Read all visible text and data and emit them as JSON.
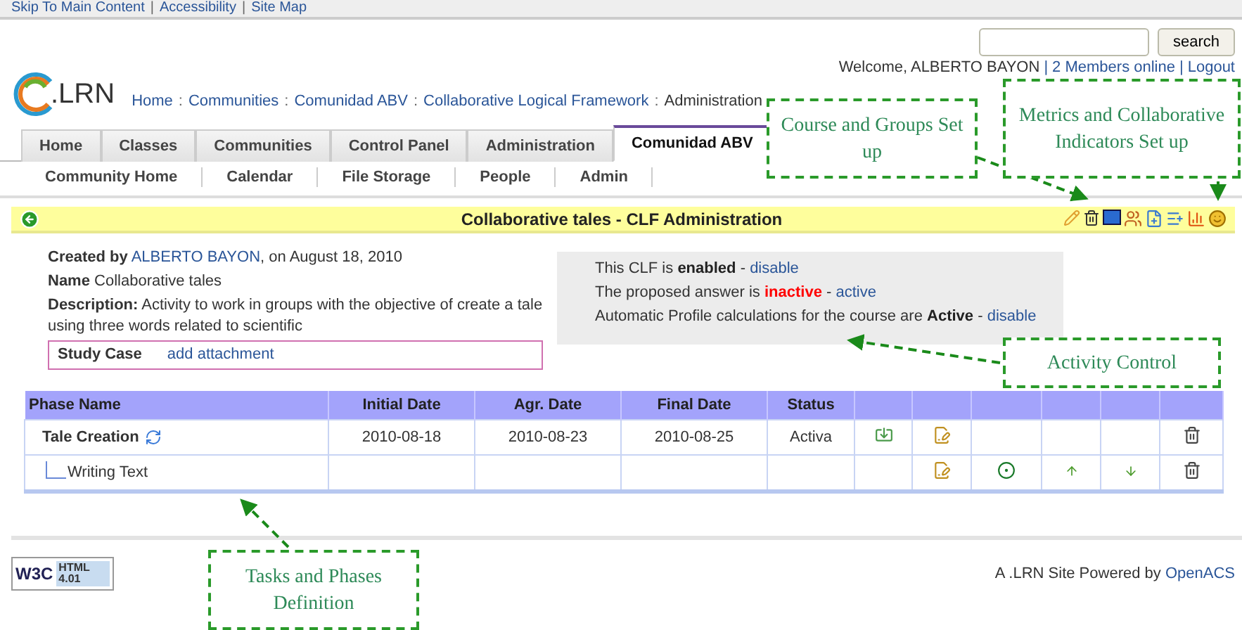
{
  "skip_links": [
    "Skip To Main Content",
    "Accessibility",
    "Site Map"
  ],
  "separators": {
    "links": "|",
    "breadcrumbs": ":"
  },
  "search": {
    "button": "search"
  },
  "welcome": {
    "text": "Welcome, ALBERTO BAYON",
    "links": [
      "2 Members online",
      "Logout"
    ]
  },
  "logo": {
    "text": ".LRN"
  },
  "breadcrumbs": [
    {
      "label": "Home",
      "link": true
    },
    {
      "label": "Communities",
      "link": true
    },
    {
      "label": "Comunidad ABV",
      "link": true
    },
    {
      "label": "Collaborative Logical Framework",
      "link": true
    },
    {
      "label": "Administration",
      "link": false
    }
  ],
  "tabs": [
    {
      "label": "Home",
      "selected": false
    },
    {
      "label": "Classes",
      "selected": false
    },
    {
      "label": "Communities",
      "selected": false
    },
    {
      "label": "Control Panel",
      "selected": false
    },
    {
      "label": "Administration",
      "selected": false
    },
    {
      "label": "Comunidad ABV",
      "selected": true
    }
  ],
  "subnav": [
    "Community Home",
    "Calendar",
    "File Storage",
    "People",
    "Admin"
  ],
  "title_bar": {
    "title": "Collaborative tales - CLF Administration"
  },
  "details": [
    {
      "label": "Created by",
      "link": "ALBERTO BAYON",
      "text": ", on August 18, 2010"
    },
    {
      "label": "Name",
      "text": "Collaborative tales"
    },
    {
      "label": "Description:",
      "text": "Activity to work in groups with the objective of create a tale using three words related to scientific"
    }
  ],
  "study_case": {
    "label": "Study Case",
    "link": "add attachment"
  },
  "status_box": [
    {
      "prefix": "This CLF is",
      "state": "enabled",
      "alert": false,
      "suffix": "-",
      "link": "disable"
    },
    {
      "prefix": "The proposed answer is",
      "state": "inactive",
      "alert": true,
      "suffix": "-",
      "link": "active"
    },
    {
      "prefix": "Automatic Profile calculations for the course are",
      "state": "Active",
      "alert": false,
      "suffix": "-",
      "link": "disable"
    }
  ],
  "table": {
    "columns": [
      "Phase Name",
      "Initial Date",
      "Agr. Date",
      "Final Date",
      "Status"
    ],
    "phases": [
      {
        "name": "Tale Creation",
        "initial_date": "2010-08-18",
        "agr_date": "2010-08-23",
        "final_date": "2010-08-25",
        "status": "Activa",
        "actions": [
          {
            "kind": "import"
          },
          {
            "kind": "edit"
          },
          {
            "kind": "empty"
          },
          {
            "kind": "empty"
          },
          {
            "kind": "empty"
          },
          {
            "kind": "delete"
          }
        ],
        "children": [
          {
            "name": "Writing Text",
            "actions": [
              {
                "kind": "empty"
              },
              {
                "kind": "edit"
              },
              {
                "kind": "view"
              },
              {
                "kind": "up"
              },
              {
                "kind": "down"
              },
              {
                "kind": "delete"
              }
            ]
          }
        ]
      }
    ]
  },
  "footer": {
    "badge": [
      "W3C",
      "HTML",
      "4.01"
    ],
    "text": "A .LRN Site Powered by",
    "link": "OpenACS"
  },
  "callouts": [
    {
      "text": "Course and Groups Set up"
    },
    {
      "text": "Metrics and Collaborative Indicators Set up"
    },
    {
      "text": "Activity Control"
    },
    {
      "text": "Tasks and Phases Definition"
    }
  ]
}
